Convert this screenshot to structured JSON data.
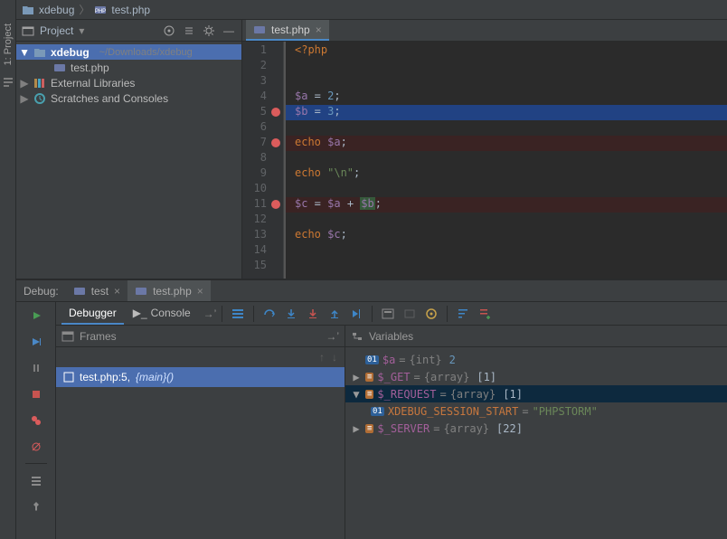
{
  "breadcrumb": {
    "project": "xdebug",
    "file": "test.php"
  },
  "sidebar": {
    "project_tab": "1: Project",
    "struct_icon": "structure"
  },
  "project_panel": {
    "title": "Project",
    "root": {
      "name": "xdebug",
      "path": "~/Downloads/xdebug"
    },
    "file": "test.php",
    "ext_libs": "External Libraries",
    "scratches": "Scratches and Consoles"
  },
  "editor": {
    "tab": "test.php",
    "lines": [
      "1",
      "2",
      "3",
      "4",
      "5",
      "6",
      "7",
      "8",
      "9",
      "10",
      "11",
      "12",
      "13",
      "14",
      "15"
    ],
    "bp_lines": [
      5,
      7,
      11
    ],
    "exec_line": 5,
    "code": {
      "l1": {
        "kw": "<?php"
      },
      "l4": {
        "v": "$a",
        "eq": " = ",
        "n": "2",
        "sc": ";"
      },
      "l5": {
        "v": "$b",
        "eq": " = ",
        "n": "3",
        "sc": ";"
      },
      "l7": {
        "e": "echo ",
        "v": "$a",
        "sc": ";"
      },
      "l9": {
        "e": "echo ",
        "s": "\"\\n\"",
        "sc": ";"
      },
      "l11": {
        "v": "$c",
        "eq": " = ",
        "v2": "$a",
        "op": " + ",
        "v3": "$b",
        "sc": ";"
      },
      "l13": {
        "e": "echo ",
        "v": "$c",
        "sc": ";"
      }
    }
  },
  "debug": {
    "title": "Debug:",
    "runs": [
      {
        "name": "test",
        "active": false
      },
      {
        "name": "test.php",
        "active": true
      }
    ],
    "tabs": {
      "debugger": "Debugger",
      "console": "Console"
    },
    "frames": {
      "title": "Frames",
      "row": {
        "file": "test.php:5,",
        "fn": "{main}()"
      }
    },
    "vars": {
      "title": "Variables",
      "a": {
        "name": "$a",
        "type": "{int}",
        "val": "2"
      },
      "get": {
        "name": "$_GET",
        "type": "{array}",
        "count": "[1]"
      },
      "req": {
        "name": "$_REQUEST",
        "type": "{array}",
        "count": "[1]"
      },
      "sess": {
        "name": "XDEBUG_SESSION_START",
        "val": "\"PHPSTORM\""
      },
      "srv": {
        "name": "$_SERVER",
        "type": "{array}",
        "count": "[22]"
      }
    }
  }
}
